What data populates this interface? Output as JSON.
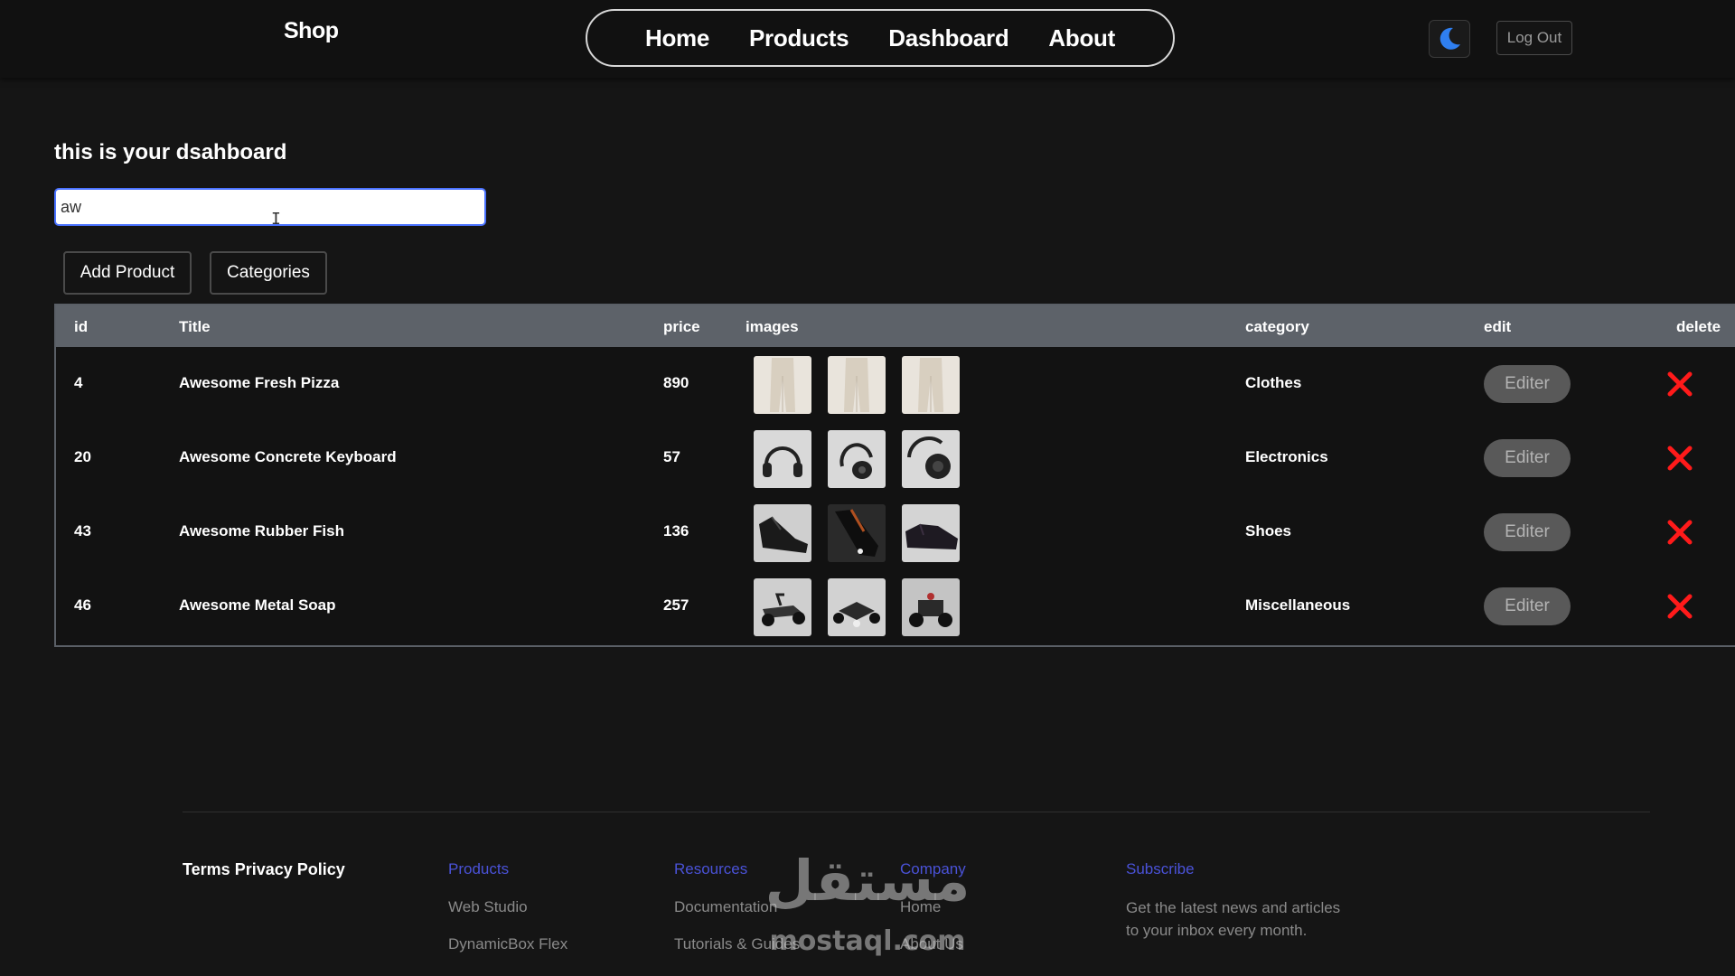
{
  "header": {
    "brand": "Shop",
    "nav": [
      "Home",
      "Products",
      "Dashboard",
      "About"
    ],
    "theme_icon": "moon-icon",
    "logout_label": "Log Out"
  },
  "dashboard": {
    "heading": "this is your dsahboard",
    "search_value": "aw",
    "add_product_label": "Add Product",
    "categories_label": "Categories"
  },
  "table": {
    "headers": {
      "id": "id",
      "title": "Title",
      "price": "price",
      "images": "images",
      "category": "category",
      "edit": "edit",
      "delete": "delete"
    },
    "edit_label": "Editer",
    "delete_icon": "close-icon",
    "rows": [
      {
        "id": "4",
        "title": "Awesome Fresh Pizza",
        "price": "890",
        "category": "Clothes",
        "images": [
          "pants-image",
          "pants-image",
          "pants-image"
        ]
      },
      {
        "id": "20",
        "title": "Awesome Concrete Keyboard",
        "price": "57",
        "category": "Electronics",
        "images": [
          "headphones-image",
          "headphones-image",
          "headphones-image"
        ]
      },
      {
        "id": "43",
        "title": "Awesome Rubber Fish",
        "price": "136",
        "category": "Shoes",
        "images": [
          "shoe-image",
          "shoe-image",
          "shoe-image"
        ]
      },
      {
        "id": "46",
        "title": "Awesome Metal Soap",
        "price": "257",
        "category": "Miscellaneous",
        "images": [
          "go-kart-image",
          "go-kart-image",
          "go-kart-image"
        ]
      }
    ]
  },
  "footer": {
    "terms": "Terms Privacy Policy",
    "columns": [
      {
        "heading": "Products",
        "links": [
          "Web Studio",
          "DynamicBox Flex"
        ]
      },
      {
        "heading": "Resources",
        "links": [
          "Documentation",
          "Tutorials & Guides"
        ]
      },
      {
        "heading": "Company",
        "links": [
          "Home",
          "About Us"
        ]
      }
    ],
    "subscribe": {
      "heading": "Subscribe",
      "text": "Get the latest news and articles to your inbox every month."
    }
  },
  "watermark": {
    "arabic": "مستقل",
    "latin": "mostaql.com"
  },
  "colors": {
    "background": "#151515",
    "header_bg": "#111111",
    "table_header": "#5d6269",
    "editer_bg": "#595959",
    "delete": "#ff1a1a",
    "footer_heading": "#4a52d8",
    "moon": "#2f7ff0",
    "focus": "#4a72ff"
  }
}
